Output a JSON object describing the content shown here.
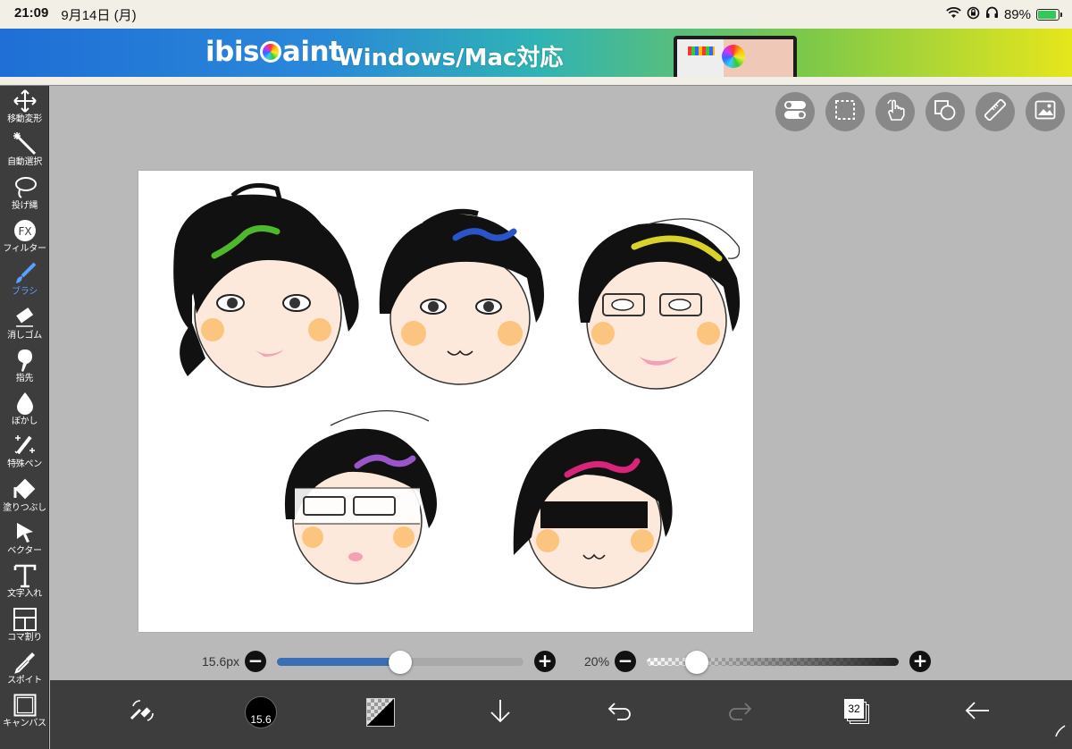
{
  "status_bar": {
    "time": "21:09",
    "date": "9月14日 (月)",
    "battery": "89%",
    "battery_level": 0.89
  },
  "ad_banner": {
    "brand_ibis": "ibis",
    "brand_paint": "aint",
    "tagline": "Windows/Mac対応"
  },
  "tools": [
    {
      "label": "移動変形",
      "icon": "move-icon"
    },
    {
      "label": "自動選択",
      "icon": "magic-wand-icon"
    },
    {
      "label": "投げ縄",
      "icon": "lasso-icon"
    },
    {
      "label": "フィルター",
      "icon": "fx-icon",
      "glyph": "FX"
    },
    {
      "label": "ブラシ",
      "icon": "brush-icon",
      "active": true
    },
    {
      "label": "消しゴム",
      "icon": "eraser-icon"
    },
    {
      "label": "指先",
      "icon": "smudge-icon"
    },
    {
      "label": "ぼかし",
      "icon": "blur-drop-icon"
    },
    {
      "label": "特殊ペン",
      "icon": "special-pen-icon"
    },
    {
      "label": "塗りつぶし",
      "icon": "bucket-icon"
    },
    {
      "label": "ベクター",
      "icon": "vector-cursor-icon"
    },
    {
      "label": "文字入れ",
      "icon": "text-icon",
      "glyph": "T"
    },
    {
      "label": "コマ割り",
      "icon": "frame-divider-icon"
    },
    {
      "label": "スポイト",
      "icon": "eyedropper-icon"
    },
    {
      "label": "キャンバス",
      "icon": "canvas-icon"
    }
  ],
  "brush_slider": {
    "value": "15.6px",
    "level": 0.5
  },
  "opacity_slider": {
    "value": "20%",
    "level": 0.2
  },
  "bottom_bar": {
    "brush_size_label": "15.6",
    "layers_count": "32"
  },
  "colors": {
    "toolbar_bg": "#3d3d3d",
    "workspace_bg": "#b9b9b9",
    "accent_blue": "#3a6fb5",
    "active_tool": "#5aa0ff"
  }
}
